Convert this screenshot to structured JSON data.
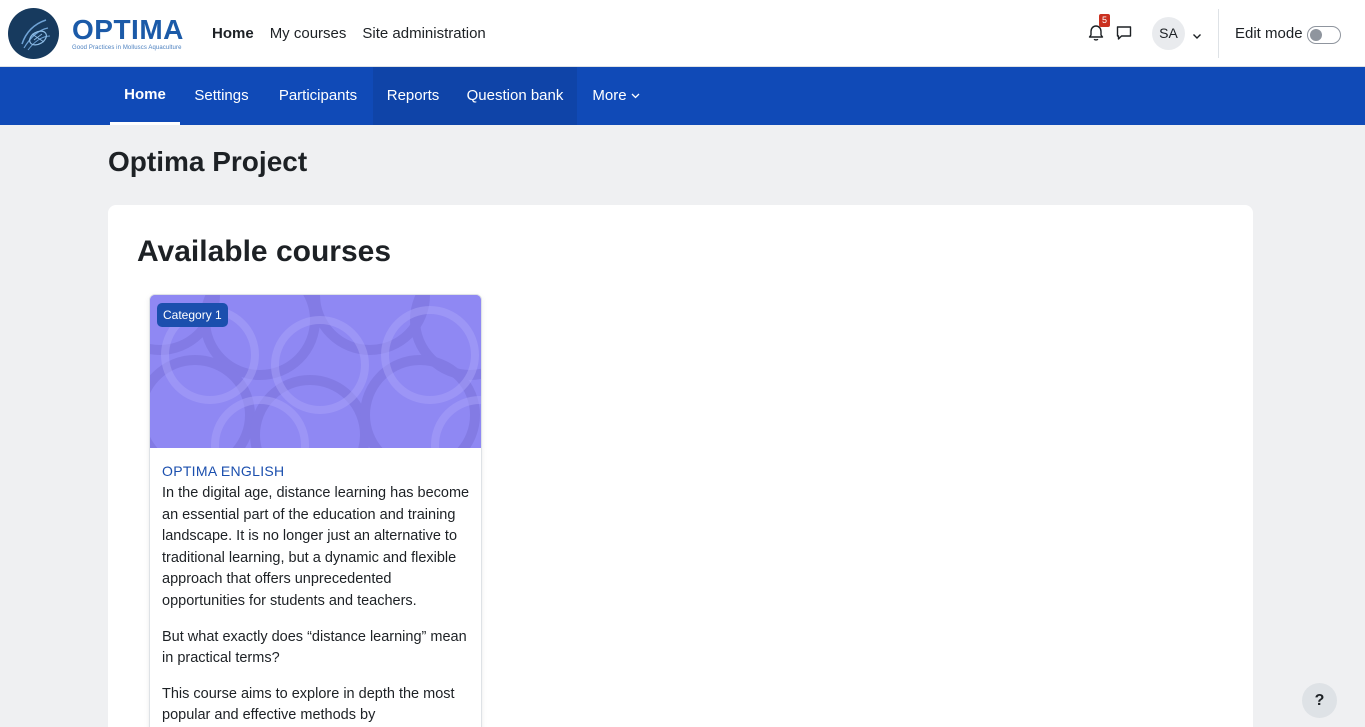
{
  "brand": {
    "name": "OPTIMA",
    "tagline": "Good Practices in Molluscs Aquaculture",
    "color": "#1b5aa8"
  },
  "primary_nav": [
    {
      "label": "Home",
      "active": true
    },
    {
      "label": "My courses",
      "active": false
    },
    {
      "label": "Site administration",
      "active": false
    }
  ],
  "user_tools": {
    "notifications_count": "5",
    "notification_icon": "bell-icon",
    "messages_icon": "chat-icon",
    "avatar_initials": "SA",
    "edit_mode_label": "Edit mode",
    "edit_mode_on": false
  },
  "secondary_nav": [
    {
      "label": "Home",
      "active": true
    },
    {
      "label": "Settings",
      "active": false
    },
    {
      "label": "Participants",
      "active": false
    },
    {
      "label": "Reports",
      "active": false
    },
    {
      "label": "Question bank",
      "active": false
    },
    {
      "label": "More",
      "active": false
    }
  ],
  "page": {
    "title": "Optima Project",
    "section_title": "Available courses"
  },
  "course": {
    "category": "Category 1",
    "name": "OPTIMA ENGLISH",
    "summary": [
      "In the digital age, distance learning has become an essential part of the education and training landscape. It is no longer just an alternative to traditional learning, but a dynamic and flexible approach that offers unprecedented opportunities for students and teachers.",
      "But what exactly does “distance learning” mean in practical terms?",
      "This course aims to explore in depth the most popular and effective methods by"
    ]
  },
  "help_label": "?",
  "colors": {
    "secondary_nav_bg": "#104ab7",
    "badge": "#ca3120",
    "course_image": "#8f88f3",
    "link": "#1b4fae"
  }
}
